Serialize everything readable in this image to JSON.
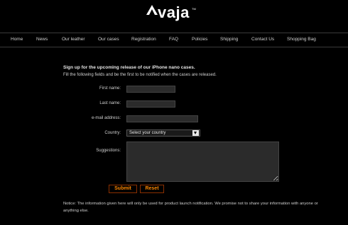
{
  "brand": {
    "logo_text": "vaja",
    "trademark": "TM"
  },
  "nav": {
    "items": [
      {
        "label": "Home"
      },
      {
        "label": "News"
      },
      {
        "label": "Our leather"
      },
      {
        "label": "Our cases"
      },
      {
        "label": "Registration"
      },
      {
        "label": "FAQ"
      },
      {
        "label": "Policies"
      },
      {
        "label": "Shipping"
      },
      {
        "label": "Contact Us"
      },
      {
        "label": "Shopping Bag"
      }
    ]
  },
  "form": {
    "heading": "Sign up for the upcoming release of our iPhone nano cases.",
    "subheading": "Fill the following fields and be the first to be notified when the cases are released.",
    "first_name_label": "First name:",
    "first_name_value": "",
    "last_name_label": "Last name:",
    "last_name_value": "",
    "email_label": "e-mail address:",
    "email_value": "",
    "country_label": "Country:",
    "country_selected": "Select your country",
    "suggestions_label": "Suggestions:",
    "suggestions_value": "",
    "submit_label": "Submit",
    "reset_label": "Reset",
    "notice": "Notice: The information given here will only be used for product launch notification. We promise not to share your information with anyone or anything else."
  },
  "colors": {
    "background": "#000000",
    "field_bg": "#2b2b2b",
    "button_text": "#ff8800",
    "button_border": "#8a2f00"
  }
}
